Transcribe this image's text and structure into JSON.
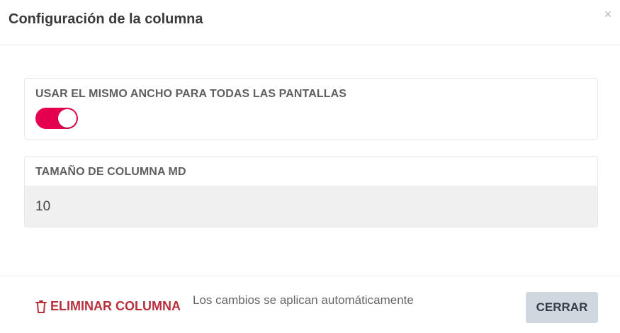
{
  "header": {
    "title": "Configuración de la columna",
    "close_symbol": "×"
  },
  "fields": {
    "same_width": {
      "label": "USAR EL MISMO ANCHO PARA TODAS LAS PANTALLAS",
      "enabled": true
    },
    "column_size": {
      "label": "TAMAÑO DE COLUMNA MD",
      "value": "10"
    }
  },
  "footer": {
    "delete_label": "ELIMINAR COLUMNA",
    "note": "Los cambios se aplican automáticamente",
    "close_label": "CERRAR"
  },
  "colors": {
    "toggle_on": "#e5004f",
    "danger": "#b8303e",
    "close_button_bg": "#cfd7df"
  },
  "icons": {
    "close": "close-icon",
    "delete": "trash-icon"
  }
}
